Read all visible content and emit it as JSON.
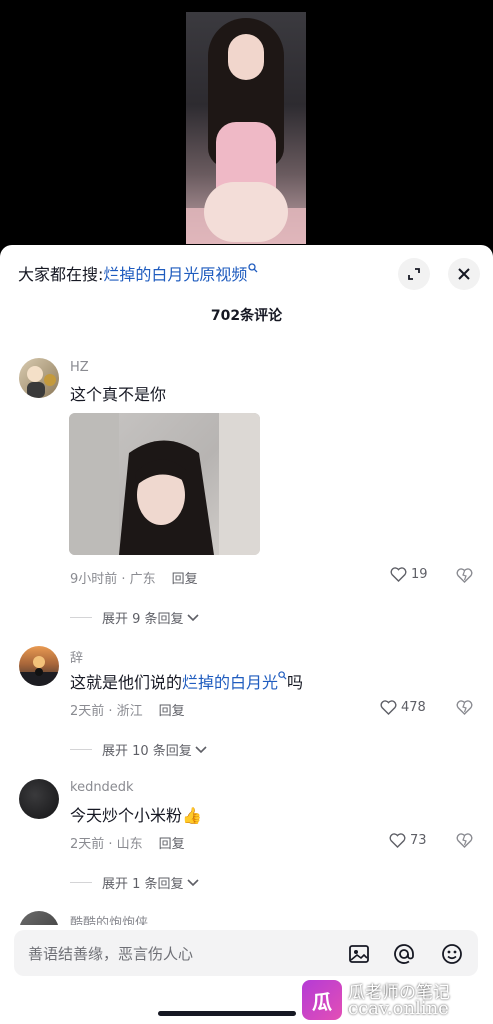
{
  "header": {
    "search_prefix": "大家都在搜:",
    "search_term": "烂掉的白月光原视频",
    "comment_count": "702条评论"
  },
  "comments": [
    {
      "name": "HZ",
      "text": "这个真不是你",
      "time_loc": "9小时前 · 广东",
      "reply": "回复",
      "likes": "19",
      "expand": "展开 9 条回复"
    },
    {
      "name": "辞",
      "text_before": "这就是他们说的",
      "text_link": "烂掉的白月光",
      "text_after": "吗",
      "time_loc": "2天前 · 浙江",
      "reply": "回复",
      "likes": "478",
      "expand": "展开 10 条回复"
    },
    {
      "name": "kedndedk",
      "text": "今天炒个小米粉",
      "emoji": "👍",
      "time_loc": "2天前 · 山东",
      "reply": "回复",
      "likes": "73",
      "expand": "展开 1 条回复"
    },
    {
      "name": "酷酷的炮炮侠"
    }
  ],
  "input": {
    "placeholder": "善语结善缘，恶言伤人心"
  },
  "watermark": {
    "line1": "瓜老师の笔记",
    "line2": "ccav.online",
    "logo": "瓜"
  },
  "icons": {
    "expand": "expand-arrows-icon",
    "close": "close-icon",
    "search": "search-icon",
    "like": "heart-icon",
    "dislike": "broken-heart-icon",
    "chevron": "chevron-down-icon",
    "image": "image-icon",
    "at": "at-icon",
    "emoji": "smiley-icon"
  },
  "colors": {
    "link": "#1f5cbf",
    "secondary": "#8a8b91"
  }
}
